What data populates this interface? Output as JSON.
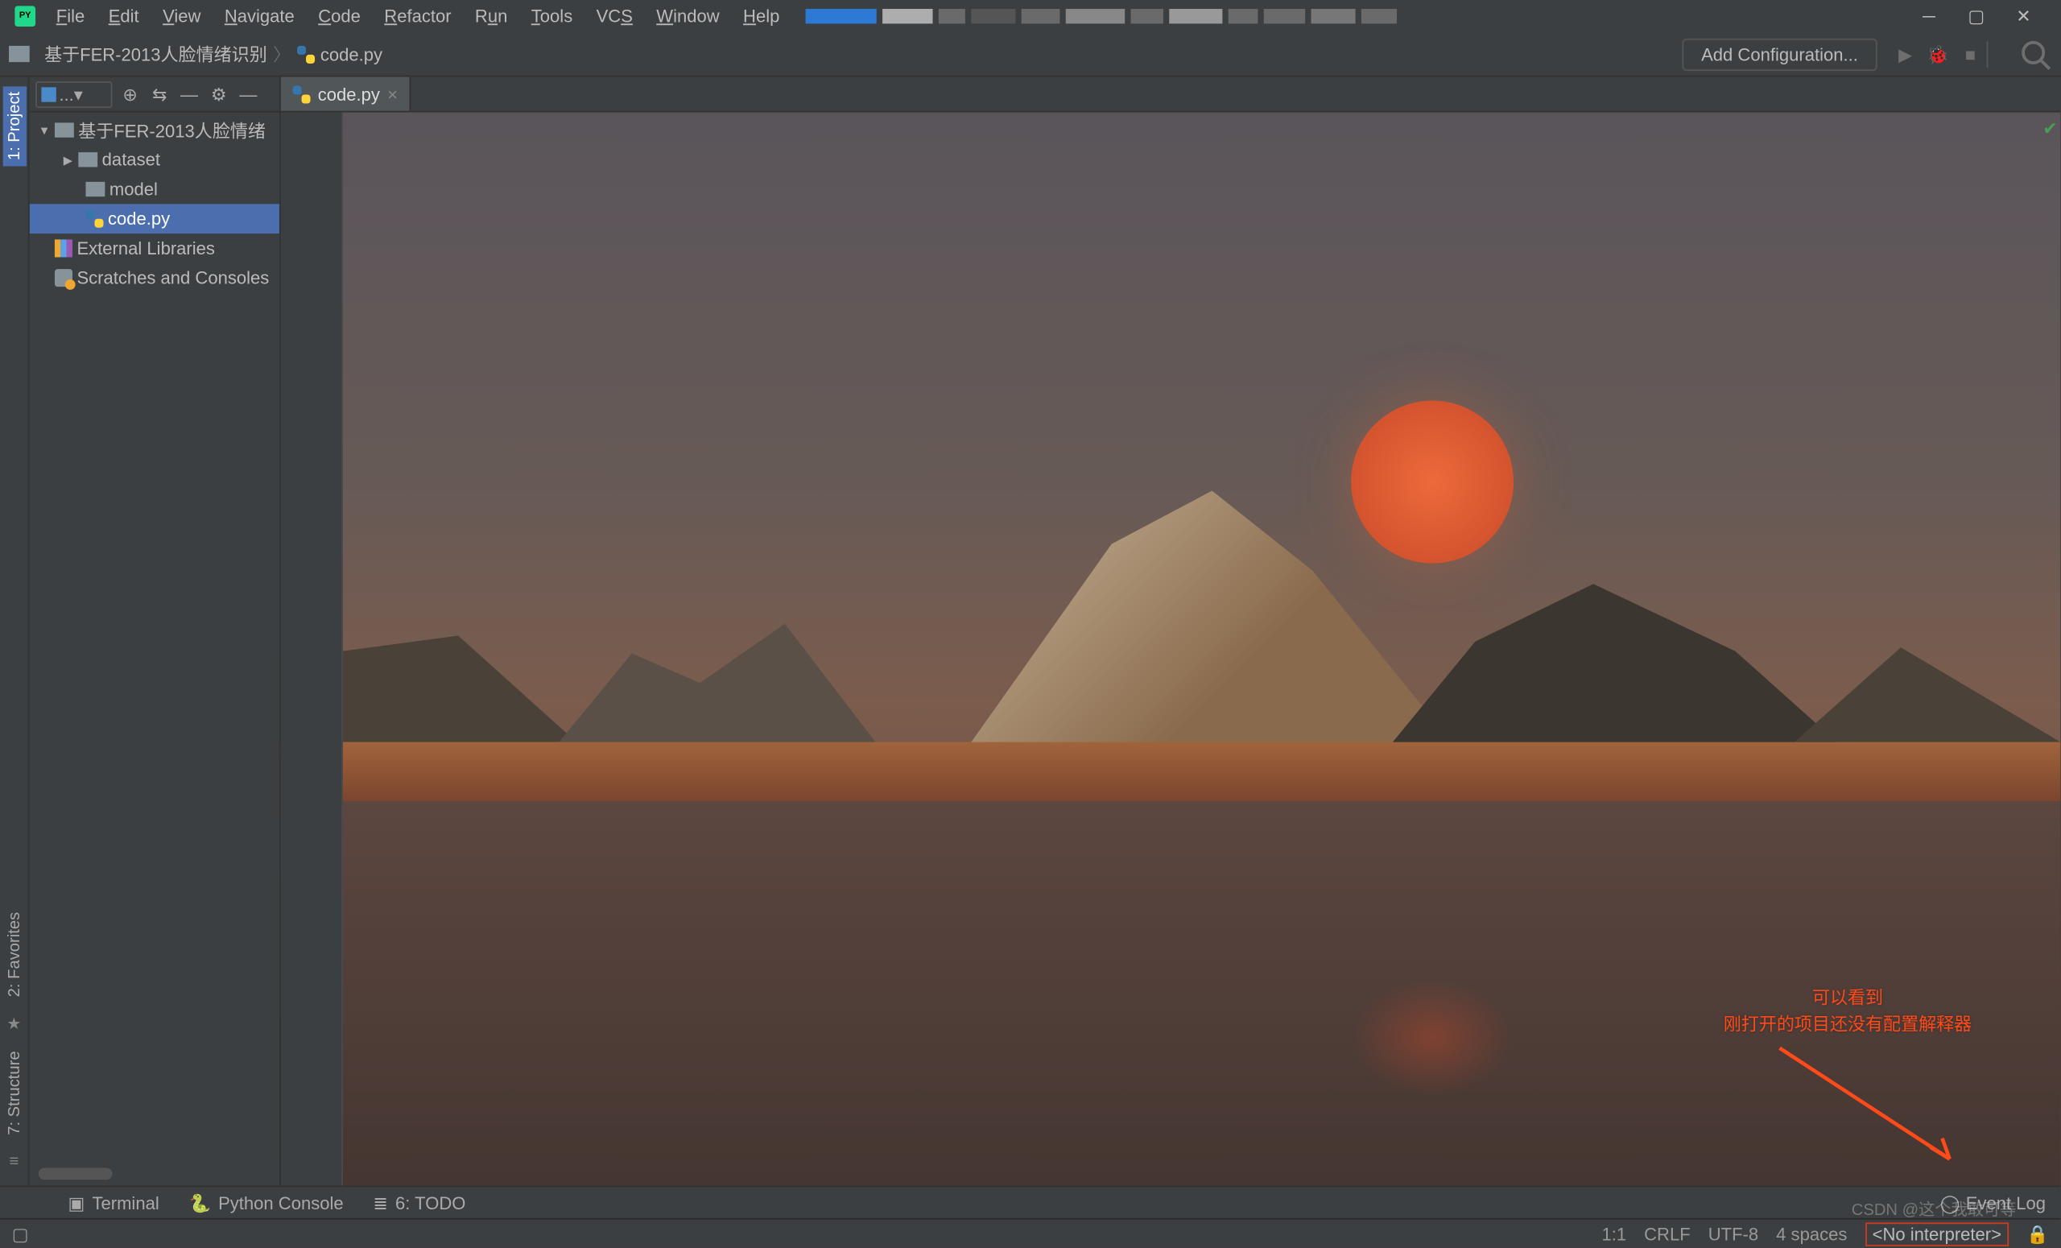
{
  "menu": {
    "file": "File",
    "edit": "Edit",
    "view": "View",
    "navigate": "Navigate",
    "code": "Code",
    "refactor": "Refactor",
    "run": "Run",
    "tools": "Tools",
    "vcs": "VCS",
    "window": "Window",
    "help": "Help"
  },
  "breadcrumb": {
    "project": "基于FER-2013人脸情绪识别",
    "file": "code.py"
  },
  "toolbar": {
    "add_config": "Add Configuration..."
  },
  "project_panel": {
    "selector": "...▾"
  },
  "tree": {
    "root": "基于FER-2013人脸情绪",
    "dataset": "dataset",
    "model": "model",
    "codepy": "code.py",
    "ext_lib": "External Libraries",
    "scratches": "Scratches and Consoles"
  },
  "rails": {
    "project": "1: Project",
    "favorites": "2: Favorites",
    "structure": "7: Structure"
  },
  "tab": {
    "name": "code.py"
  },
  "annotation": {
    "line1": "可以看到",
    "line2": "刚打开的项目还没有配置解释器"
  },
  "bottom": {
    "terminal": "Terminal",
    "py_console": "Python Console",
    "todo": "6: TODO",
    "event_log": "Event Log"
  },
  "status": {
    "pos": "1:1",
    "lineend": "CRLF",
    "encoding": "UTF-8",
    "indent": "4 spaces",
    "interpreter": "<No interpreter>"
  },
  "watermark": "CSDN @这个我敢可等"
}
